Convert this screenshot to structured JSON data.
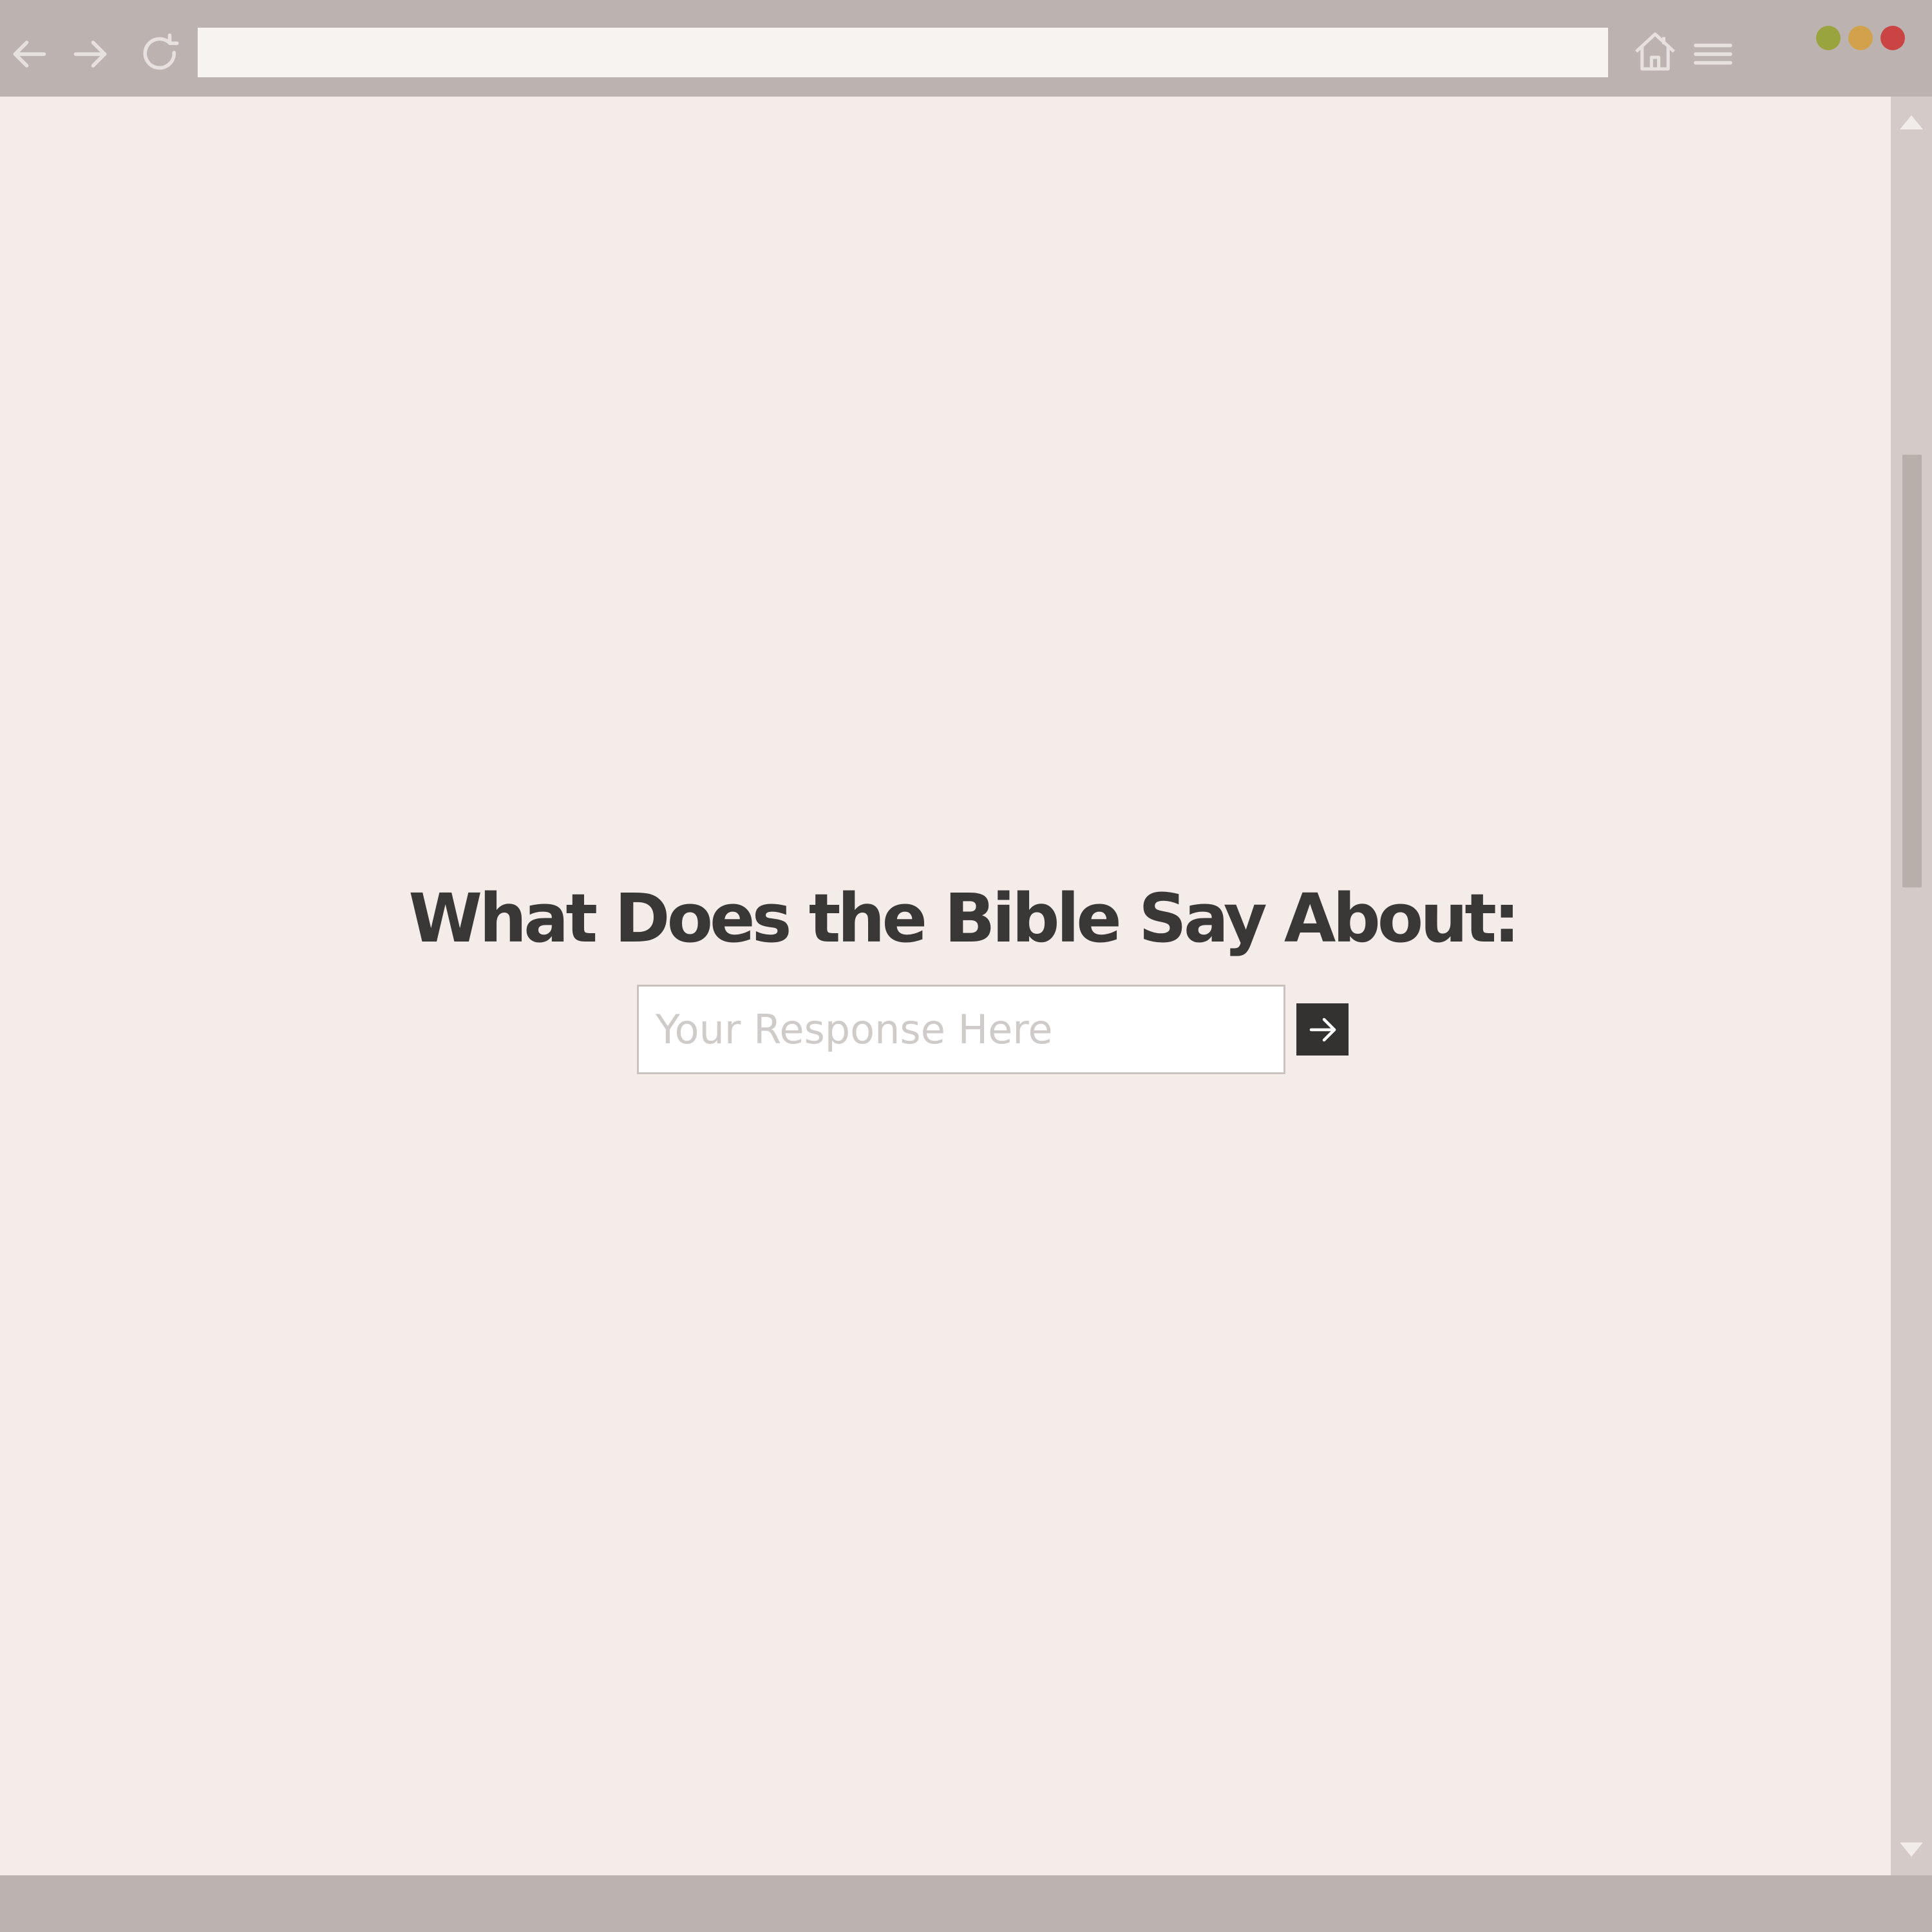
{
  "browser": {
    "url": "",
    "icons": {
      "back": "arrow-left",
      "forward": "arrow-right",
      "reload": "reload",
      "home": "home",
      "menu": "hamburger-menu"
    },
    "window_controls": {
      "green": "#9aa43f",
      "yellow": "#d1a24b",
      "red": "#cb4444"
    }
  },
  "main": {
    "heading": "What Does the Bible Say About:",
    "response_placeholder": "Your Response Here",
    "submit_icon": "arrow-right"
  },
  "colors": {
    "chrome": "#bcb3b0",
    "page_background": "#f4ece9",
    "heading_text": "#3a3836",
    "button": "#333231"
  }
}
